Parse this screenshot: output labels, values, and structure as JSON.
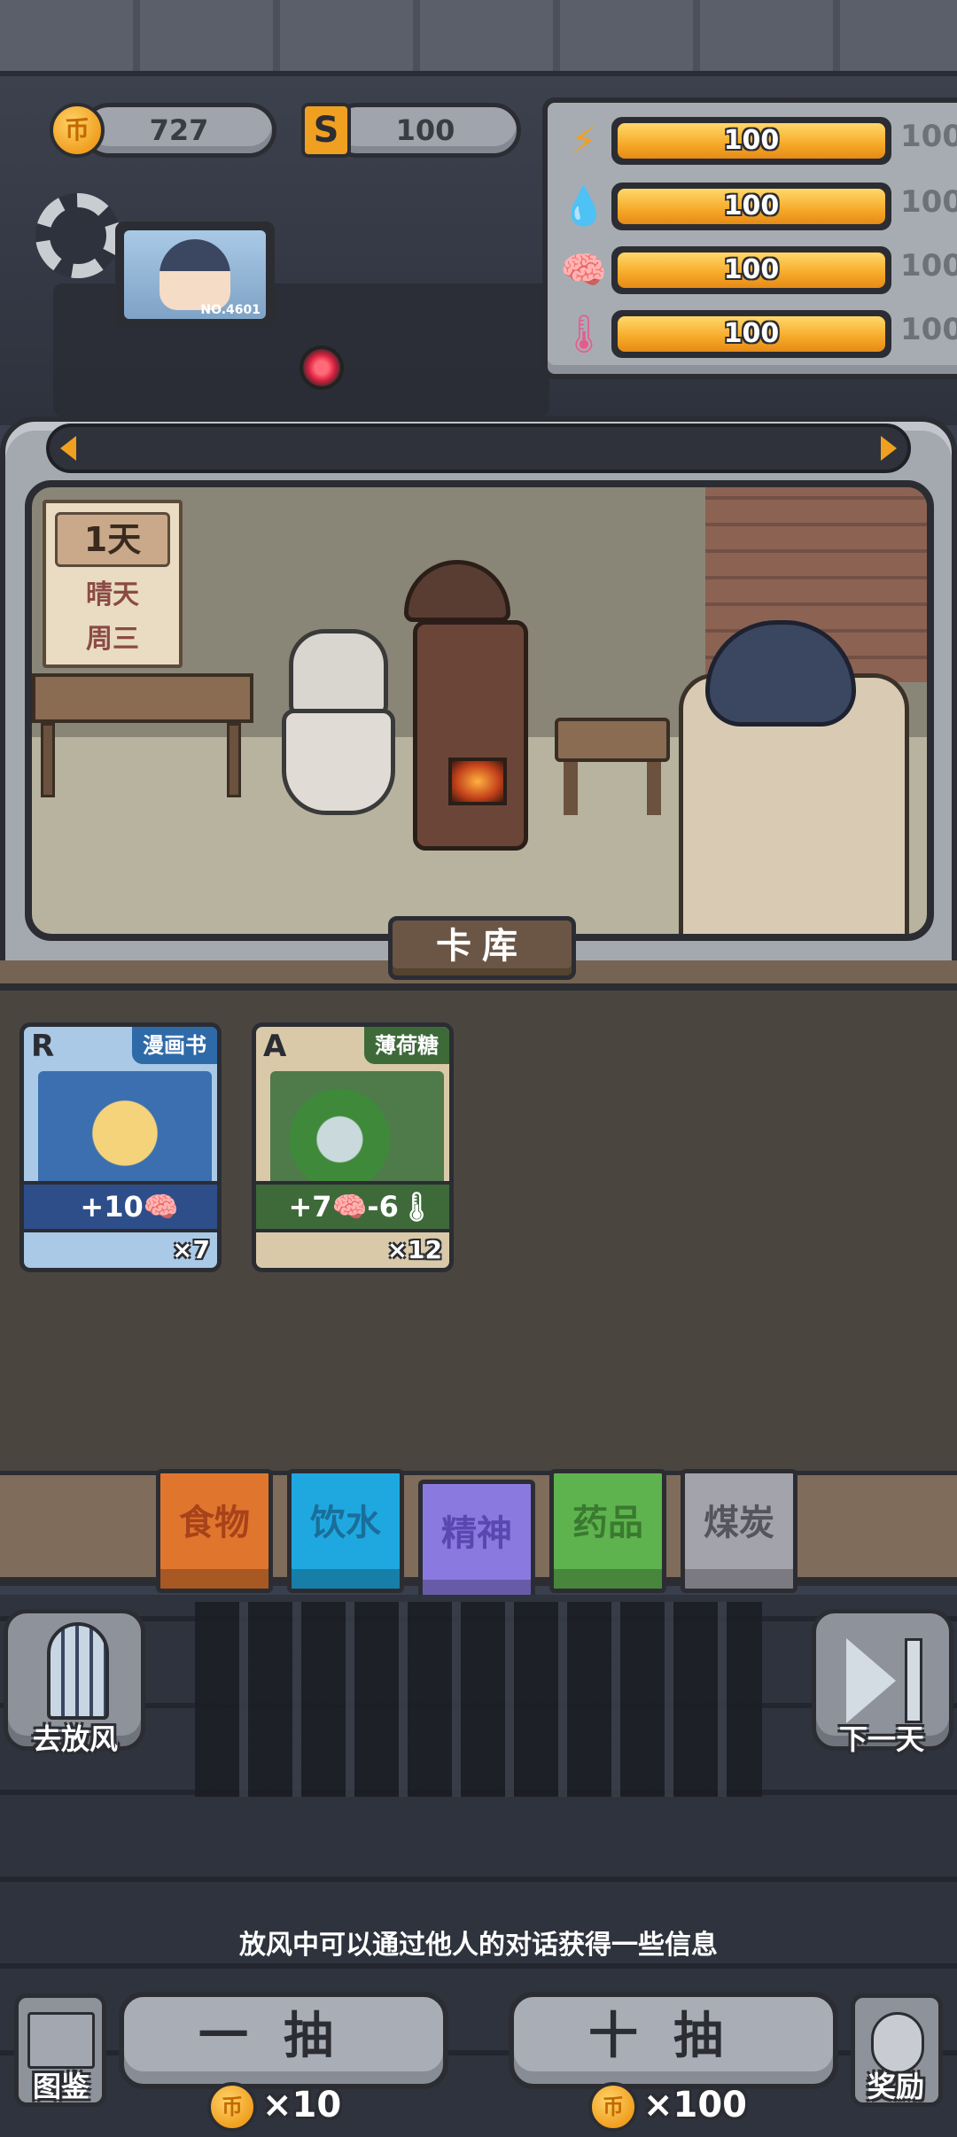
{
  "currency": {
    "coins": "727",
    "coin_glyph": "币",
    "s_glyph": "S",
    "gems": "100"
  },
  "stats": [
    {
      "name": "energy",
      "icon": "⚡",
      "icon_name": "lightning-icon",
      "color": "#f0a020",
      "value": "100",
      "max": "100",
      "fill": 1.0
    },
    {
      "name": "water",
      "icon": "💧",
      "icon_name": "water-drop-icon",
      "color": "#3aa0e8",
      "value": "100",
      "max": "100",
      "fill": 1.0
    },
    {
      "name": "spirit",
      "icon": "🧠",
      "icon_name": "brain-icon",
      "color": "#7a70e0",
      "value": "100",
      "max": "100",
      "fill": 1.0
    },
    {
      "name": "temperature",
      "icon": "🌡",
      "icon_name": "thermometer-icon",
      "color": "#e85a8a",
      "value": "100",
      "max": "100",
      "fill": 1.0
    }
  ],
  "monitor": {
    "label": "NO.4601"
  },
  "calendar": {
    "day": "1天",
    "weather": "晴天",
    "weekday": "周三"
  },
  "library": {
    "title": "卡库",
    "cards": [
      {
        "grade": "R",
        "name": "漫画书",
        "effect": "+10🧠",
        "count": "×7",
        "bg": "#a9c9e6",
        "tag_bg": "#2e6aa8",
        "effect_bg": "#2e4e8a",
        "art_bg": "#3b6fb0"
      },
      {
        "grade": "A",
        "name": "薄荷糖",
        "effect": "+7🧠-6🌡",
        "count": "×12",
        "bg": "#d9c9a9",
        "tag_bg": "#3e6a3a",
        "effect_bg": "#3e6a3a",
        "art_bg": "#4f7a4a"
      }
    ]
  },
  "tabs": [
    {
      "label": "食物",
      "bg": "#e0762e",
      "fg": "#a8421a"
    },
    {
      "label": "饮水",
      "bg": "#1fa8e0",
      "fg": "#1a6e9a"
    },
    {
      "label": "精神",
      "bg": "#8a7ae0",
      "fg": "#5a48b0"
    },
    {
      "label": "药品",
      "bg": "#5fb34f",
      "fg": "#3a7a30"
    },
    {
      "label": "煤炭",
      "bg": "#a3a3ab",
      "fg": "#55565c"
    }
  ],
  "actions": {
    "go_out": "去放风",
    "next_day": "下一天",
    "hint": "放风中可以通过他人的对话获得一些信息",
    "draw_one": "一抽",
    "draw_one_cost": "×10",
    "draw_ten": "十抽",
    "draw_ten_cost": "×100",
    "guide": "图鉴",
    "reward": "奖励"
  }
}
